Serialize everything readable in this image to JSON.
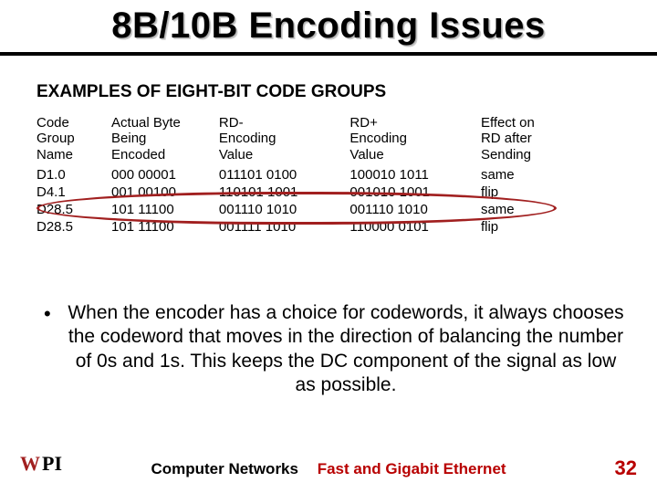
{
  "title": "8B/10B Encoding Issues",
  "section_heading": "EXAMPLES OF EIGHT-BIT CODE GROUPS",
  "table": {
    "headers": {
      "name": "Code\nGroup\nName",
      "byte": "Actual Byte\nBeing\nEncoded",
      "rdm": "RD-\nEncoding\nValue",
      "rdp": "RD+\nEncoding\nValue",
      "effect": "Effect on\nRD after\nSending"
    },
    "rows": [
      {
        "name": "D1.0",
        "byte": "000 00001",
        "rdm": "011101 0100",
        "rdp": "100010 1011",
        "effect": "same"
      },
      {
        "name": "D4.1",
        "byte": "001 00100",
        "rdm": "110101 1001",
        "rdp": "001010 1001",
        "effect": "flip"
      },
      {
        "name": "D28.5",
        "byte": "101 11100",
        "rdm": "001110 1010",
        "rdp": "001110 1010",
        "effect": "same"
      },
      {
        "name": "D28.5",
        "byte": "101 11100",
        "rdm": "001111 1010",
        "rdp": "110000 0101",
        "effect": "flip"
      }
    ]
  },
  "bullet": "When the encoder has a choice for codewords, it always chooses the codeword that moves in the direction of balancing the number of  0s and 1s. This keeps the DC component of the signal as low as possible.",
  "footer": {
    "topic": "Computer Networks",
    "subtopic": "Fast and Gigabit Ethernet",
    "page": "32"
  },
  "logo_text": "WPI"
}
